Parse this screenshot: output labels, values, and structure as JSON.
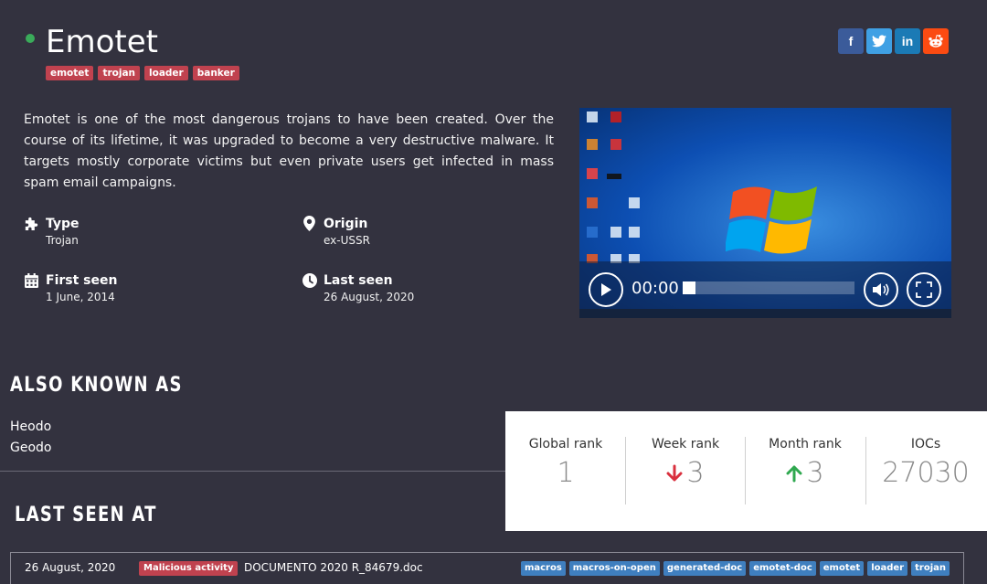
{
  "header": {
    "name": "Emotet",
    "status_color": "#3aab5a",
    "tags": [
      "emotet",
      "trojan",
      "loader",
      "banker"
    ]
  },
  "social": {
    "facebook": "f",
    "twitter": "twitter-icon",
    "linkedin": "in",
    "reddit": "reddit-icon"
  },
  "description": "Emotet is one of the most dangerous trojans to have been created. Over the course of its lifetime, it was upgraded to become a very destructive malware. It targets mostly corporate victims but even private users get infected in mass spam email campaigns.",
  "facts": {
    "type": {
      "label": "Type",
      "value": "Trojan",
      "icon": "puzzle-icon"
    },
    "origin": {
      "label": "Origin",
      "value": "ex-USSR",
      "icon": "map-marker-icon"
    },
    "first_seen": {
      "label": "First seen",
      "value": "1 June, 2014",
      "icon": "calendar-icon"
    },
    "last_seen": {
      "label": "Last seen",
      "value": "26 August, 2020",
      "icon": "clock-icon"
    }
  },
  "video": {
    "timecode": "00:00",
    "progress": 0
  },
  "also_known_as": {
    "title": "ALSO KNOWN AS",
    "names": [
      "Heodo",
      "Geodo"
    ]
  },
  "ranks": {
    "global": {
      "label": "Global rank",
      "value": "1"
    },
    "week": {
      "label": "Week rank",
      "value": "3",
      "trend": "down",
      "trend_color": "#d9303e"
    },
    "month": {
      "label": "Month rank",
      "value": "3",
      "trend": "up",
      "trend_color": "#2fa84f"
    },
    "iocs": {
      "label": "IOCs",
      "value": "27030"
    }
  },
  "last_seen_at": {
    "title": "LAST SEEN AT",
    "rows": [
      {
        "date": "26 August, 2020",
        "verdict": "Malicious activity",
        "file": "DOCUMENTO 2020 R_84679.doc",
        "tags": [
          "macros",
          "macros-on-open",
          "generated-doc",
          "emotet-doc",
          "emotet",
          "loader",
          "trojan"
        ]
      }
    ]
  }
}
